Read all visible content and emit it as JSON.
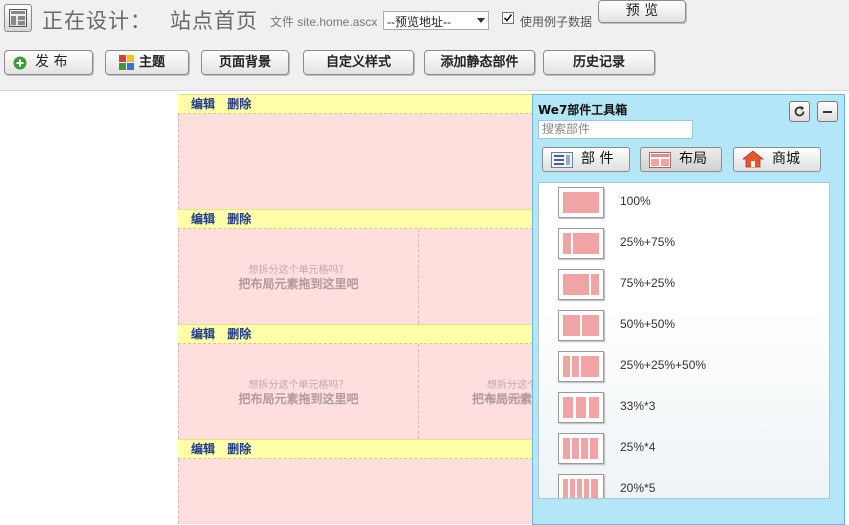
{
  "header": {
    "title_prefix": "正在设计：",
    "page_name": "站点首页",
    "file_label": "文件 site.home.ascx",
    "preview_select": "--预览地址--",
    "use_sample_label": "使用例子数据",
    "use_sample_checked": true,
    "preview_button": "预 览"
  },
  "toolbar": {
    "publish": "发 布",
    "theme": "主题",
    "page_bg": "页面背景",
    "custom_style": "自定义样式",
    "add_static": "添加静态部件",
    "history": "历史记录"
  },
  "canvas": {
    "edit": "编辑",
    "delete": "删除",
    "hint_split": "想拆分这个单元格吗？",
    "hint_drag": "把布局元素拖到这里吧",
    "hint_drag_cut": "把布局元素"
  },
  "toolbox": {
    "title": "We7部件工具箱",
    "search_placeholder": "搜索部件",
    "tabs": [
      "部 件",
      "布局",
      "商城"
    ],
    "active_tab": "布局",
    "layouts": [
      "100%",
      "25%+75%",
      "75%+25%",
      "50%+50%",
      "25%+25%+50%",
      "33%*3",
      "25%*4",
      "20%*5"
    ]
  },
  "colors": {
    "row_bar": "#ffffaa",
    "row_body": "#ffdede",
    "toolbox_bg": "#b3e6f6",
    "link": "#23408a"
  }
}
